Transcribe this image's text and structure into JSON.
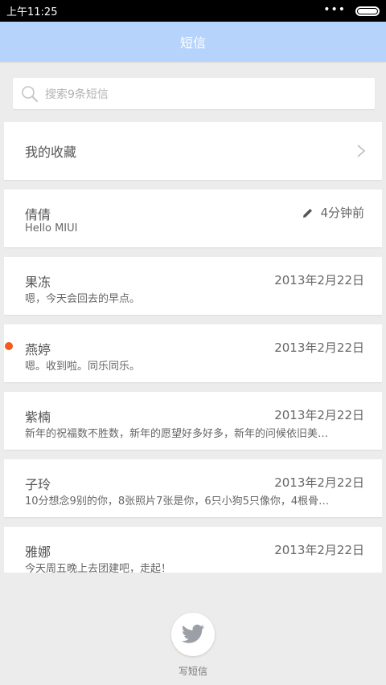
{
  "status_bar": {
    "time": "上午11:25",
    "dots": "•••"
  },
  "header": {
    "title": "短信"
  },
  "search": {
    "placeholder": "搜索9条短信"
  },
  "favorites": {
    "label": "我的收藏"
  },
  "messages": [
    {
      "name": "倩倩",
      "time": "4分钟前",
      "preview": "Hello MIUI",
      "draft": true,
      "unread": false
    },
    {
      "name": "果冻",
      "time": "2013年2月22日",
      "preview": "嗯，今天会回去的早点。",
      "draft": false,
      "unread": false
    },
    {
      "name": "燕婷",
      "time": "2013年2月22日",
      "preview": "嗯。收到啦。同乐同乐。",
      "draft": false,
      "unread": true
    },
    {
      "name": "紫楠",
      "time": "2013年2月22日",
      "preview": "新年的祝福数不胜数，新年的愿望好多好多，新年的问候依旧美…",
      "draft": false,
      "unread": false
    },
    {
      "name": "子玲",
      "time": "2013年2月22日",
      "preview": "10分想念9别的你，8张照片7张是你，6只小狗5只像你，4根骨…",
      "draft": false,
      "unread": false
    },
    {
      "name": "雅娜",
      "time": "2013年2月22日",
      "preview": "今天周五晚上去团建吧，走起！",
      "draft": false,
      "unread": false
    }
  ],
  "compose": {
    "label": "写短信"
  },
  "colors": {
    "header": "#b6d4fb",
    "unread": "#f25a1e",
    "background": "#ececec"
  }
}
